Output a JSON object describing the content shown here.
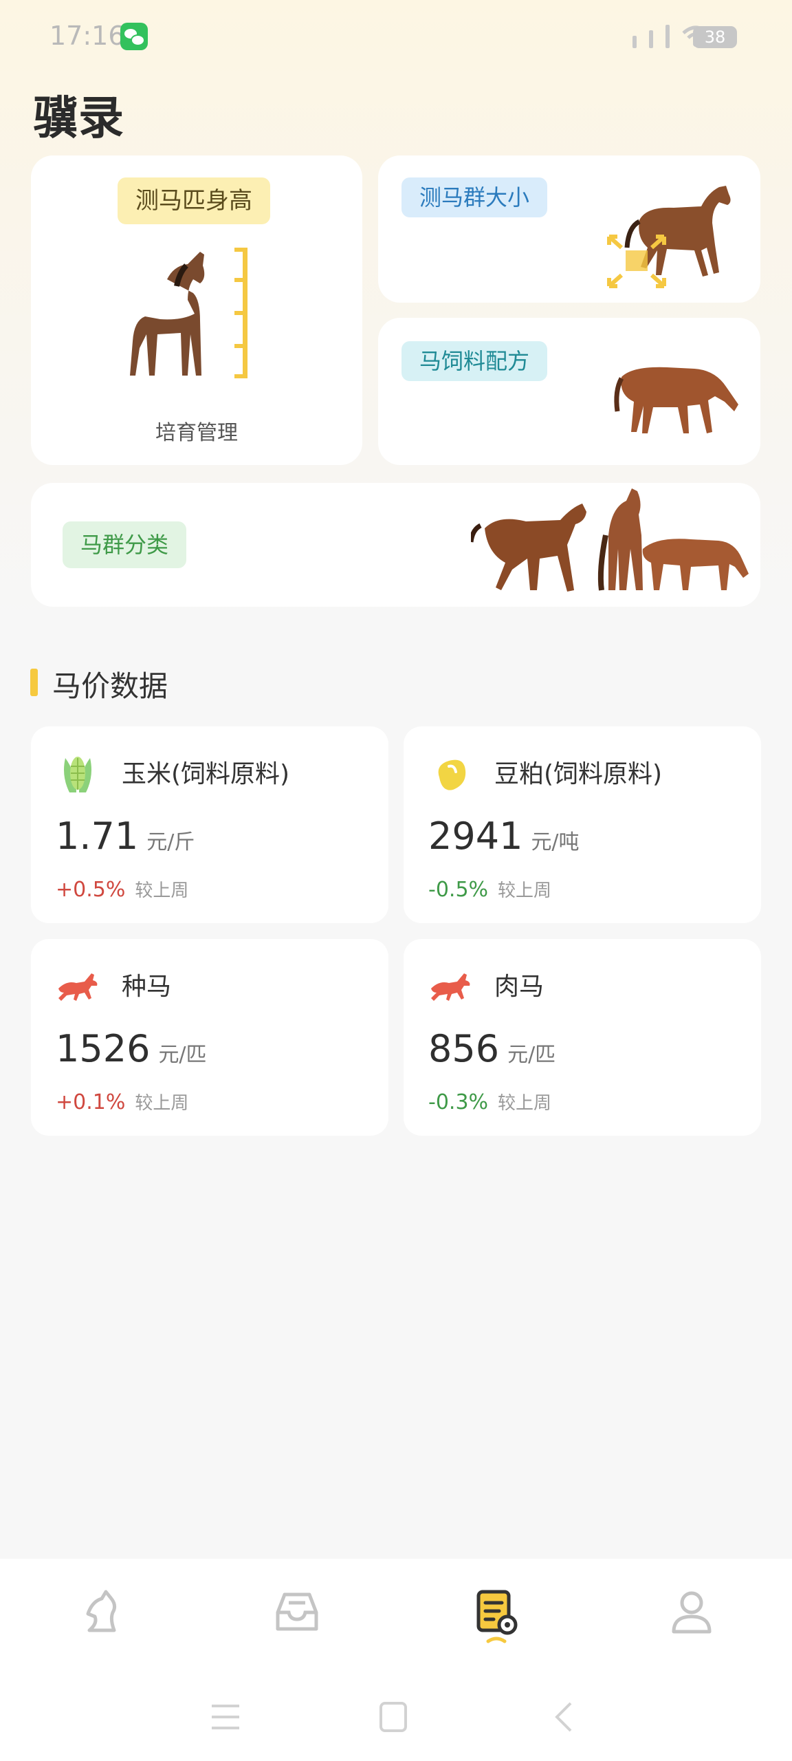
{
  "status_bar": {
    "time": "17:16",
    "battery": "38"
  },
  "app": {
    "title": "骥录"
  },
  "features": {
    "height": {
      "tag": "测马匹身高",
      "caption": "培育管理"
    },
    "herd_size": {
      "tag": "测马群大小"
    },
    "feed": {
      "tag": "马饲料配方"
    },
    "classify": {
      "tag": "马群分类"
    }
  },
  "section": {
    "title": "马价数据"
  },
  "prices": [
    {
      "name": "玉米(饲料原料)",
      "value": "1.71",
      "unit": "元/斤",
      "change": "+0.5%",
      "compare": "较上周",
      "icon": "corn-icon",
      "trend": "up"
    },
    {
      "name": "豆粕(饲料原料)",
      "value": "2941",
      "unit": "元/吨",
      "change": "-0.5%",
      "compare": "较上周",
      "icon": "bean-icon",
      "trend": "down"
    },
    {
      "name": "种马",
      "value": "1526",
      "unit": "元/匹",
      "change": "+0.1%",
      "compare": "较上周",
      "icon": "horse-icon",
      "trend": "up"
    },
    {
      "name": "肉马",
      "value": "856",
      "unit": "元/匹",
      "change": "-0.3%",
      "compare": "较上周",
      "icon": "horse-icon",
      "trend": "down"
    }
  ],
  "tabs": [
    {
      "icon": "horse-head-icon",
      "active": false
    },
    {
      "icon": "inbox-icon",
      "active": false
    },
    {
      "icon": "report-settings-icon",
      "active": true
    },
    {
      "icon": "user-icon",
      "active": false
    }
  ],
  "colors": {
    "accent": "#f6c93f",
    "up": "#d0483f",
    "down": "#3f9a48",
    "tab_inactive": "#c4c4c4",
    "tab_active": "#333333"
  }
}
